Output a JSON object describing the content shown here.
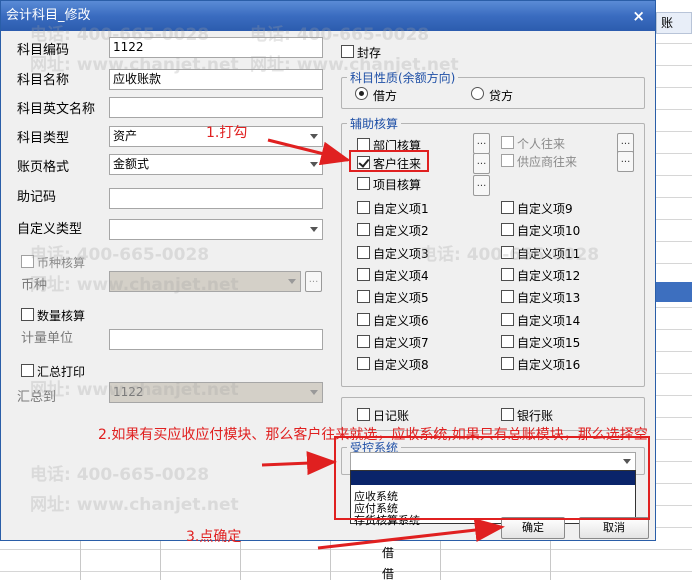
{
  "dialog": {
    "title": "会计科目_修改",
    "close_label": "×"
  },
  "left": {
    "code_label": "科目编码",
    "code_value": "1122",
    "name_label": "科目名称",
    "name_value": "应收账款",
    "english_label": "科目英文名称",
    "english_value": "",
    "type_label": "科目类型",
    "type_value": "资产",
    "format_label": "账页格式",
    "format_value": "金额式",
    "mnemonic_label": "助记码",
    "mnemonic_value": "",
    "custom_type_label": "自定义类型",
    "custom_type_value": "",
    "currency_check_label": "币种核算",
    "currency_label": "币种",
    "qty_check_label": "数量核算",
    "unit_label": "计量单位",
    "summary_check_label": "汇总打印",
    "summary_to_label": "汇总到",
    "summary_to_value": "1122"
  },
  "right": {
    "sealed_label": "封存",
    "nature_title": "科目性质(余额方向)",
    "debit_label": "借方",
    "credit_label": "贷方",
    "aux_title": "辅助核算",
    "dept_label": "部门核算",
    "personal_label": "个人往来",
    "customer_label": "客户往来",
    "supplier_label": "供应商往来",
    "project_label": "项目核算",
    "custom_items": [
      "自定义项1",
      "自定义项2",
      "自定义项3",
      "自定义项4",
      "自定义项5",
      "自定义项6",
      "自定义项7",
      "自定义项8"
    ],
    "custom_items_right": [
      "自定义项9",
      "自定义项10",
      "自定义项11",
      "自定义项12",
      "自定义项13",
      "自定义项14",
      "自定义项15",
      "自定义项16"
    ],
    "journal_label": "日记账",
    "bank_label": "银行账",
    "controlled_title": "受控系统",
    "controlled_options": [
      "",
      "应收系统",
      "应付系统",
      "存货核算系统"
    ],
    "ok_label": "确定",
    "cancel_label": "取消"
  },
  "annotations": {
    "step1": "1.打勾",
    "step2": "2.如果有买应收应付模块、那么客户往来就选，应收系统,如果只有总账模块，那么选择空",
    "step3": "3.点确定"
  },
  "background": {
    "right_header": "账",
    "bottom_cells": [
      "借",
      "借"
    ]
  },
  "watermarks": {
    "phone": "电话: 400-665-0028",
    "site": "网址: www.chanjet.net"
  },
  "colors": {
    "title_bar": "#3a6cc0",
    "annotation_red": "#e02020",
    "group_title_blue": "#1e4fa6",
    "selected_item": "#0a246a"
  }
}
